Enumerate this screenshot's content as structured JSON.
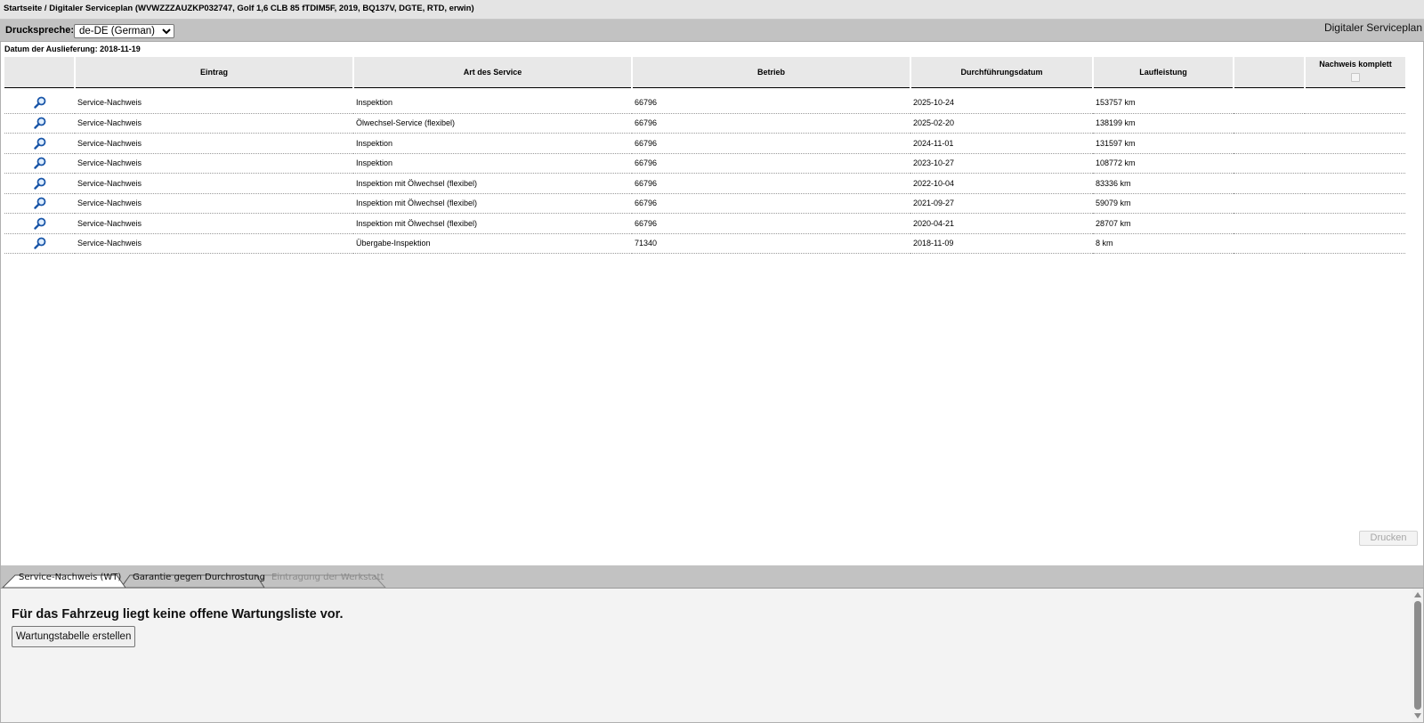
{
  "breadcrumb": "Startseite / Digitaler Serviceplan (WVWZZZAUZKP032747, Golf 1,6 CLB 85 fTDIM5F, 2019, BQ137V, DGTE, RTD, erwin)",
  "toolbar": {
    "print_language_label": "Druckspreche:",
    "print_language_value": "de-DE (German)",
    "view_title": "Digitaler Serviceplan"
  },
  "delivery_date": "Datum der Auslieferung: 2018-11-19",
  "table": {
    "headers": [
      "",
      "Eintrag",
      "Art des Service",
      "Betrieb",
      "Durchführungsdatum",
      "Laufleistung",
      "",
      "Nachweis komplett"
    ],
    "rows": [
      {
        "icon": "magnifier-icon",
        "eintrag": "Service-Nachweis",
        "art": "Inspektion",
        "betrieb": "66796",
        "datum": "2025-10-24",
        "laufleistung": "153757 km"
      },
      {
        "icon": "magnifier-icon",
        "eintrag": "Service-Nachweis",
        "art": "Ölwechsel-Service (flexibel)",
        "betrieb": "66796",
        "datum": "2025-02-20",
        "laufleistung": "138199 km"
      },
      {
        "icon": "magnifier-icon",
        "eintrag": "Service-Nachweis",
        "art": "Inspektion",
        "betrieb": "66796",
        "datum": "2024-11-01",
        "laufleistung": "131597 km"
      },
      {
        "icon": "magnifier-icon",
        "eintrag": "Service-Nachweis",
        "art": "Inspektion",
        "betrieb": "66796",
        "datum": "2023-10-27",
        "laufleistung": "108772 km"
      },
      {
        "icon": "magnifier-icon",
        "eintrag": "Service-Nachweis",
        "art": "Inspektion mit Ölwechsel (flexibel)",
        "betrieb": "66796",
        "datum": "2022-10-04",
        "laufleistung": "83336 km"
      },
      {
        "icon": "magnifier-icon",
        "eintrag": "Service-Nachweis",
        "art": "Inspektion mit Ölwechsel (flexibel)",
        "betrieb": "66796",
        "datum": "2021-09-27",
        "laufleistung": "59079 km"
      },
      {
        "icon": "magnifier-icon",
        "eintrag": "Service-Nachweis",
        "art": "Inspektion mit Ölwechsel (flexibel)",
        "betrieb": "66796",
        "datum": "2020-04-21",
        "laufleistung": "28707 km"
      },
      {
        "icon": "magnifier-icon",
        "eintrag": "Service-Nachweis",
        "art": "Übergabe-Inspektion",
        "betrieb": "71340",
        "datum": "2018-11-09",
        "laufleistung": "8 km"
      }
    ]
  },
  "print_button": "Drucken",
  "tabs": [
    {
      "label": "Service-Nachweis (WT)",
      "active": true,
      "enabled": true
    },
    {
      "label": "Garantie gegen Durchrostung",
      "active": false,
      "enabled": true
    },
    {
      "label": "Eintragung der Werkstatt",
      "active": false,
      "enabled": false
    }
  ],
  "lower": {
    "message": "Für das Fahrzeug liegt keine offene Wartungsliste vor.",
    "create_button": "Wartungstabelle erstellen"
  },
  "colors": {
    "toolbar_bg": "#c2c2c2",
    "header_bg": "#e8e8e8",
    "icon_blue": "#1a56a8"
  }
}
